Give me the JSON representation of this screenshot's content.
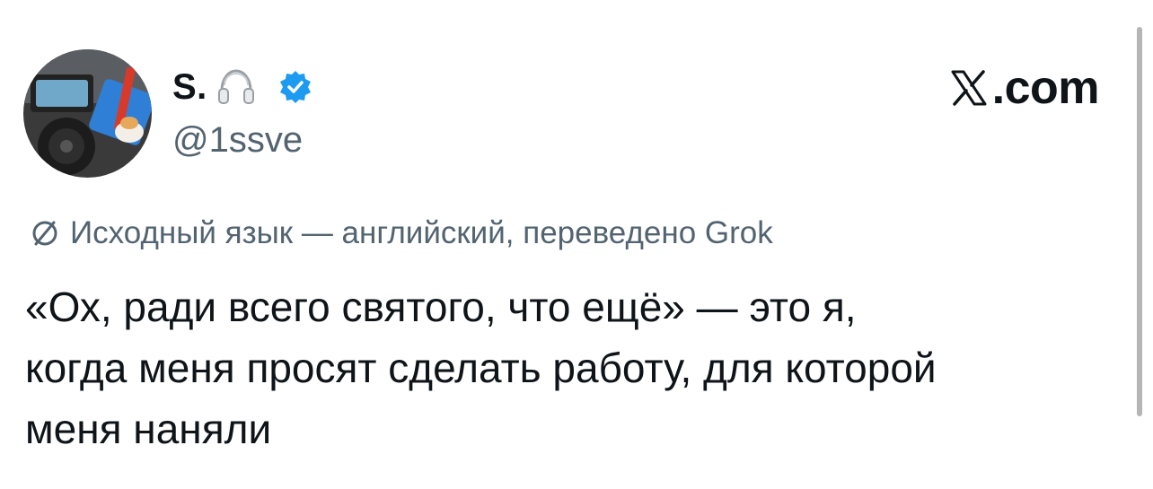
{
  "author": {
    "display_name": "S.",
    "handle": "@1ssve",
    "verified": true,
    "avatar_icon": "avatar-photo",
    "name_emoji_icon": "headphones-icon",
    "verified_color": "#1d9bf0"
  },
  "brand": {
    "logo_icon": "x-logo-icon",
    "domain": ".com"
  },
  "translation": {
    "icon": "translate-icon",
    "note": "Исходный язык — английский, переведено Grok"
  },
  "tweet": {
    "text": "«Ох, ради всего святого, что ещё» — это я,\nкогда меня просят сделать работу, для которой\nменя наняли"
  },
  "colors": {
    "text_primary": "#0f1419",
    "text_secondary": "#536471",
    "verified_blue": "#1d9bf0"
  }
}
